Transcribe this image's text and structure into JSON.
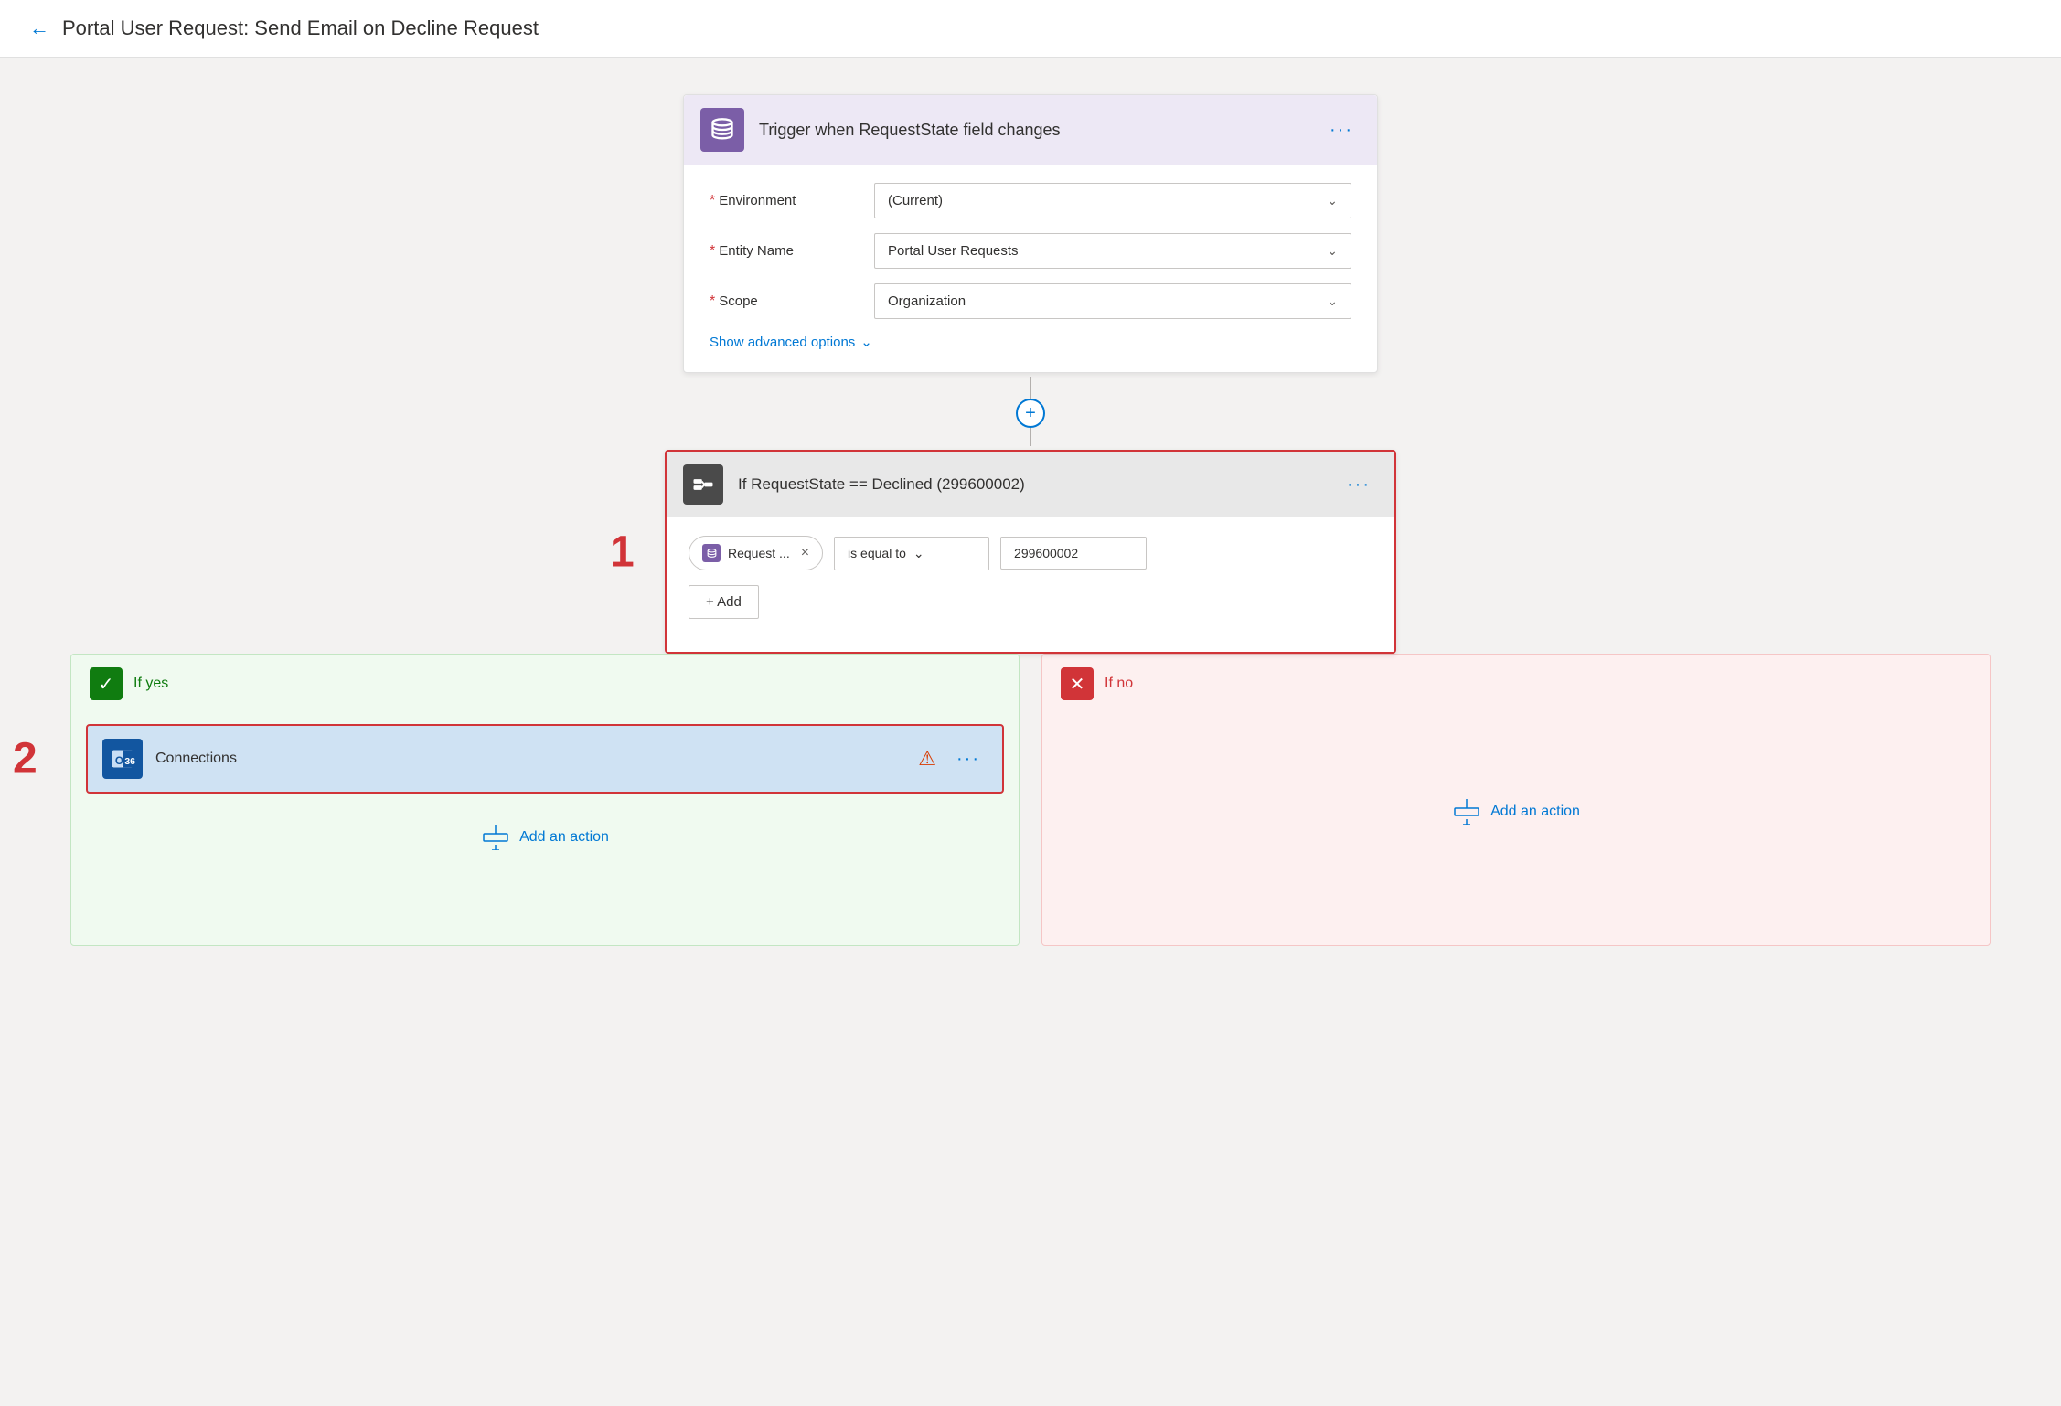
{
  "header": {
    "back_label": "←",
    "title": "Portal User Request: Send Email on Decline Request"
  },
  "trigger": {
    "icon_label": "database-icon",
    "title": "Trigger when RequestState field changes",
    "more_label": "···",
    "fields": [
      {
        "label": "Environment",
        "required": true,
        "value": "(Current)"
      },
      {
        "label": "Entity Name",
        "required": true,
        "value": "Portal User Requests"
      },
      {
        "label": "Scope",
        "required": true,
        "value": "Organization"
      }
    ],
    "show_advanced": "Show advanced options"
  },
  "connector": {
    "plus_label": "+"
  },
  "condition": {
    "step_number": "1",
    "icon_label": "condition-icon",
    "title": "If RequestState == Declined (299600002)",
    "more_label": "···",
    "token_label": "Request ...",
    "token_close": "×",
    "operator_label": "is equal to",
    "value": "299600002",
    "add_label": "+ Add"
  },
  "branch_yes": {
    "header_label": "If yes",
    "action_step_number": "2",
    "action_title": "Connections",
    "more_label": "···",
    "add_action_label": "Add an action"
  },
  "branch_no": {
    "header_label": "If no",
    "add_action_label": "Add an action"
  },
  "colors": {
    "accent": "#0078d4",
    "danger": "#d13438",
    "yes_green": "#107c10",
    "purple": "#7b5ea7"
  }
}
